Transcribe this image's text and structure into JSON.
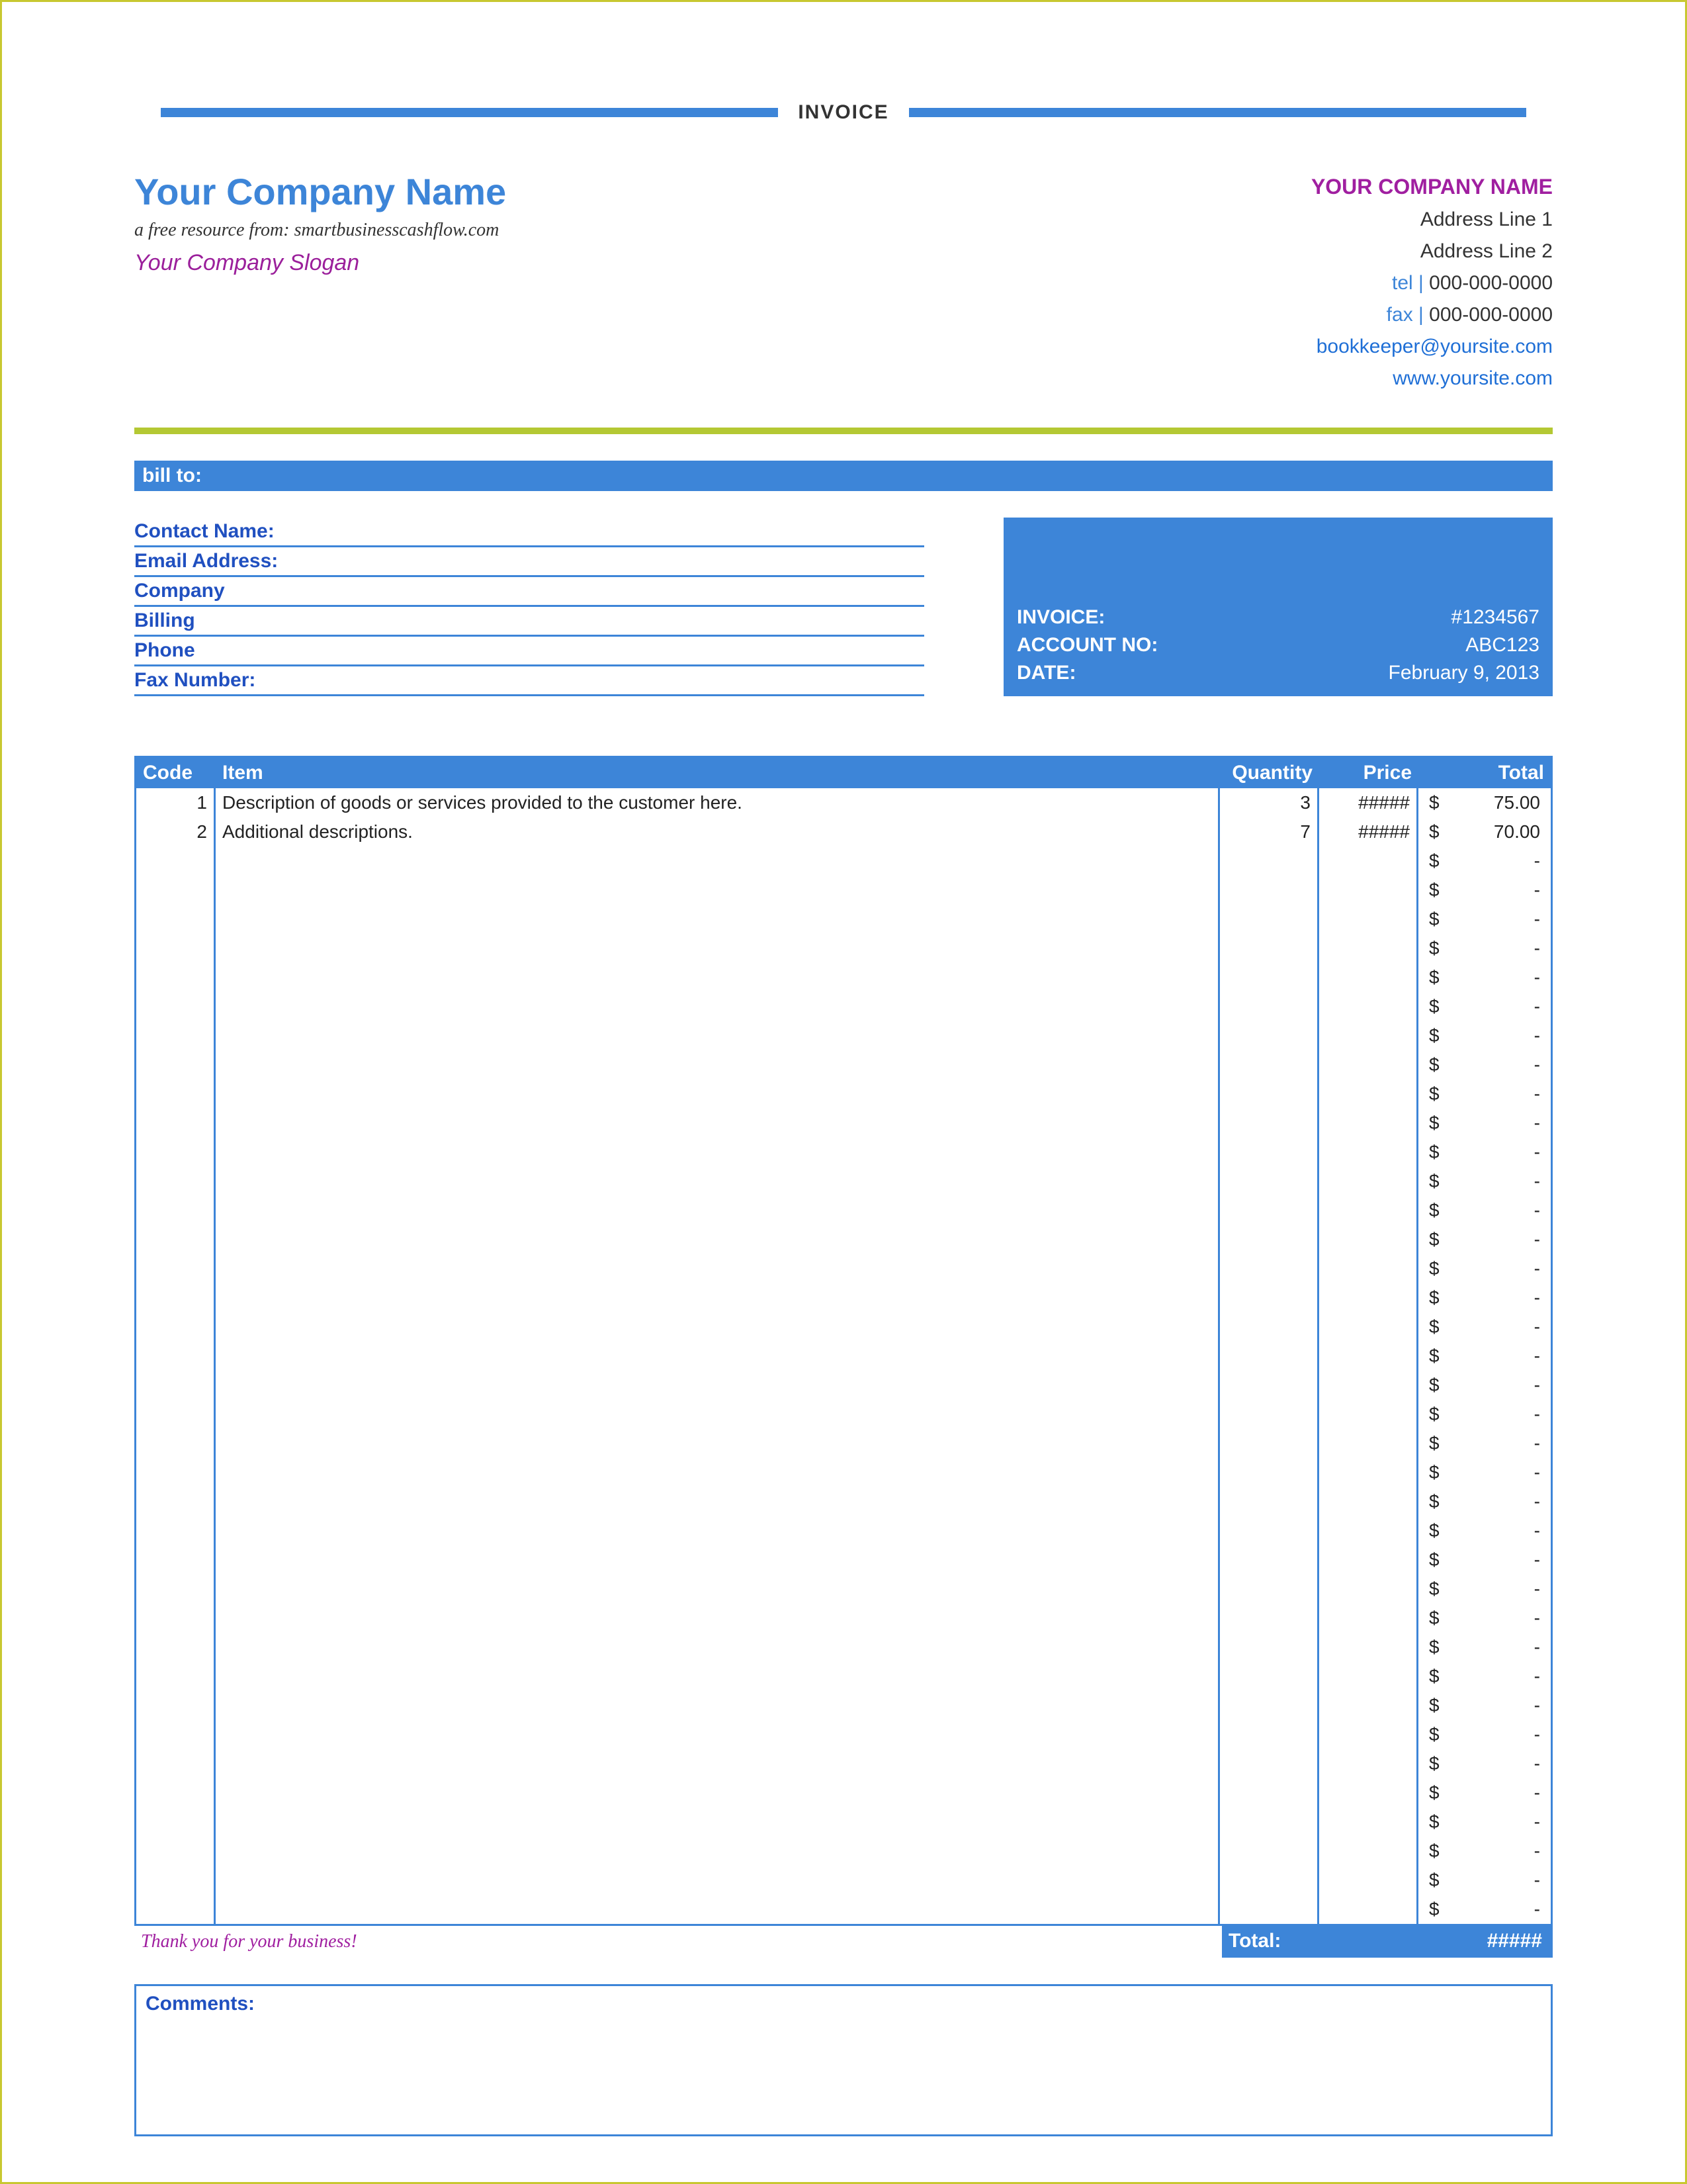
{
  "title": "INVOICE",
  "header": {
    "company_name": "Your Company Name",
    "resource_line": "a free resource from: smartbusinesscashflow.com",
    "slogan": "Your Company Slogan",
    "right": {
      "company_name": "YOUR COMPANY NAME",
      "address1": "Address Line 1",
      "address2": "Address Line 2",
      "tel_label": "tel |",
      "tel": "000-000-0000",
      "fax_label": "fax |",
      "fax": "000-000-0000",
      "email": "bookkeeper@yoursite.com",
      "website": "www.yoursite.com"
    }
  },
  "bill_to": {
    "bar_label": "bill to:",
    "fields": [
      "Contact Name:",
      "Email Address:",
      "Company",
      "Billing",
      "Phone",
      "Fax Number:"
    ],
    "meta": {
      "invoice_label": "INVOICE:",
      "invoice_no": "#1234567",
      "account_label": "ACCOUNT NO:",
      "account_no": "ABC123",
      "date_label": "DATE:",
      "date_val": "February 9, 2013"
    }
  },
  "items": {
    "headers": {
      "code": "Code",
      "item": "Item",
      "qty": "Quantity",
      "price": "Price",
      "total": "Total"
    },
    "rows": [
      {
        "code": "1",
        "item": "Description of goods or services provided to the customer here.",
        "qty": "3",
        "price": "#####",
        "currency": "$",
        "total": "75.00"
      },
      {
        "code": "2",
        "item": "Additional descriptions.",
        "qty": "7",
        "price": "#####",
        "currency": "$",
        "total": "70.00"
      },
      {
        "code": "",
        "item": "",
        "qty": "",
        "price": "",
        "currency": "$",
        "total": "-"
      },
      {
        "code": "",
        "item": "",
        "qty": "",
        "price": "",
        "currency": "$",
        "total": "-"
      },
      {
        "code": "",
        "item": "",
        "qty": "",
        "price": "",
        "currency": "$",
        "total": "-"
      },
      {
        "code": "",
        "item": "",
        "qty": "",
        "price": "",
        "currency": "$",
        "total": "-"
      },
      {
        "code": "",
        "item": "",
        "qty": "",
        "price": "",
        "currency": "$",
        "total": "-"
      },
      {
        "code": "",
        "item": "",
        "qty": "",
        "price": "",
        "currency": "$",
        "total": "-"
      },
      {
        "code": "",
        "item": "",
        "qty": "",
        "price": "",
        "currency": "$",
        "total": "-"
      },
      {
        "code": "",
        "item": "",
        "qty": "",
        "price": "",
        "currency": "$",
        "total": "-"
      },
      {
        "code": "",
        "item": "",
        "qty": "",
        "price": "",
        "currency": "$",
        "total": "-"
      },
      {
        "code": "",
        "item": "",
        "qty": "",
        "price": "",
        "currency": "$",
        "total": "-"
      },
      {
        "code": "",
        "item": "",
        "qty": "",
        "price": "",
        "currency": "$",
        "total": "-"
      },
      {
        "code": "",
        "item": "",
        "qty": "",
        "price": "",
        "currency": "$",
        "total": "-"
      },
      {
        "code": "",
        "item": "",
        "qty": "",
        "price": "",
        "currency": "$",
        "total": "-"
      },
      {
        "code": "",
        "item": "",
        "qty": "",
        "price": "",
        "currency": "$",
        "total": "-"
      },
      {
        "code": "",
        "item": "",
        "qty": "",
        "price": "",
        "currency": "$",
        "total": "-"
      },
      {
        "code": "",
        "item": "",
        "qty": "",
        "price": "",
        "currency": "$",
        "total": "-"
      },
      {
        "code": "",
        "item": "",
        "qty": "",
        "price": "",
        "currency": "$",
        "total": "-"
      },
      {
        "code": "",
        "item": "",
        "qty": "",
        "price": "",
        "currency": "$",
        "total": "-"
      },
      {
        "code": "",
        "item": "",
        "qty": "",
        "price": "",
        "currency": "$",
        "total": "-"
      },
      {
        "code": "",
        "item": "",
        "qty": "",
        "price": "",
        "currency": "$",
        "total": "-"
      },
      {
        "code": "",
        "item": "",
        "qty": "",
        "price": "",
        "currency": "$",
        "total": "-"
      },
      {
        "code": "",
        "item": "",
        "qty": "",
        "price": "",
        "currency": "$",
        "total": "-"
      },
      {
        "code": "",
        "item": "",
        "qty": "",
        "price": "",
        "currency": "$",
        "total": "-"
      },
      {
        "code": "",
        "item": "",
        "qty": "",
        "price": "",
        "currency": "$",
        "total": "-"
      },
      {
        "code": "",
        "item": "",
        "qty": "",
        "price": "",
        "currency": "$",
        "total": "-"
      },
      {
        "code": "",
        "item": "",
        "qty": "",
        "price": "",
        "currency": "$",
        "total": "-"
      },
      {
        "code": "",
        "item": "",
        "qty": "",
        "price": "",
        "currency": "$",
        "total": "-"
      },
      {
        "code": "",
        "item": "",
        "qty": "",
        "price": "",
        "currency": "$",
        "total": "-"
      },
      {
        "code": "",
        "item": "",
        "qty": "",
        "price": "",
        "currency": "$",
        "total": "-"
      },
      {
        "code": "",
        "item": "",
        "qty": "",
        "price": "",
        "currency": "$",
        "total": "-"
      },
      {
        "code": "",
        "item": "",
        "qty": "",
        "price": "",
        "currency": "$",
        "total": "-"
      },
      {
        "code": "",
        "item": "",
        "qty": "",
        "price": "",
        "currency": "$",
        "total": "-"
      },
      {
        "code": "",
        "item": "",
        "qty": "",
        "price": "",
        "currency": "$",
        "total": "-"
      },
      {
        "code": "",
        "item": "",
        "qty": "",
        "price": "",
        "currency": "$",
        "total": "-"
      },
      {
        "code": "",
        "item": "",
        "qty": "",
        "price": "",
        "currency": "$",
        "total": "-"
      },
      {
        "code": "",
        "item": "",
        "qty": "",
        "price": "",
        "currency": "$",
        "total": "-"
      },
      {
        "code": "",
        "item": "",
        "qty": "",
        "price": "",
        "currency": "$",
        "total": "-"
      }
    ],
    "thank_you": "Thank you for your business!",
    "total_label": "Total:",
    "total_value": "#####"
  },
  "comments_label": "Comments:"
}
